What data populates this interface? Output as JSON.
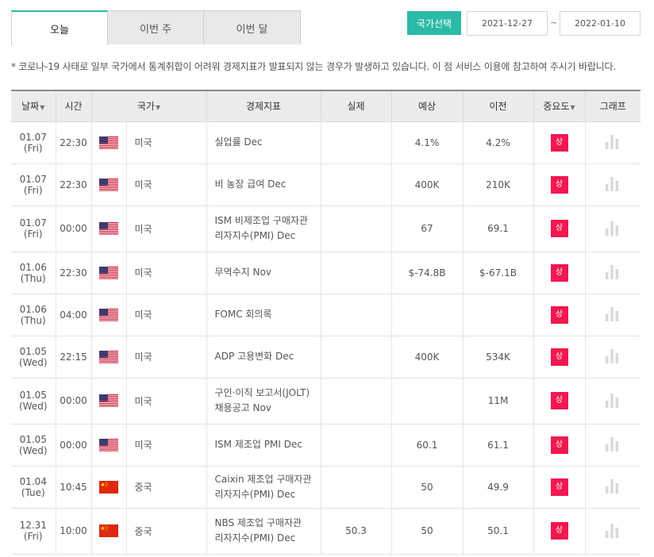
{
  "tabs": [
    {
      "label": "오늘",
      "active": true
    },
    {
      "label": "이번 주",
      "active": false
    },
    {
      "label": "이번 달",
      "active": false
    }
  ],
  "country_button": "국가선택",
  "date_range": {
    "from": "2021-12-27",
    "separator": "~",
    "to": "2022-01-10"
  },
  "notice": "* 코로나-19 사태로 일부 국가에서 통계취합이 어려워 경제지표가 발표되지 않는 경우가 발생하고 있습니다. 이 점 서비스 이용에 참고하여 주시기 바랍니다.",
  "columns": {
    "date": "날짜",
    "time": "시간",
    "country": "국가",
    "indicator": "경제지표",
    "actual": "실제",
    "forecast": "예상",
    "previous": "이전",
    "importance": "중요도",
    "graph": "그래프"
  },
  "sort_arrow": "▼",
  "colors": {
    "accent": "#2bbaa6",
    "importance_high": "#f0184f"
  },
  "rows": [
    {
      "date": "01.07",
      "day": "(Fri)",
      "time": "22:30",
      "flag": "us-flag-icon",
      "country": "미국",
      "indicator": [
        "실업률 Dec"
      ],
      "actual": "",
      "forecast": "4.1%",
      "previous": "4.2%",
      "importance": "상"
    },
    {
      "date": "01.07",
      "day": "(Fri)",
      "time": "22:30",
      "flag": "us-flag-icon",
      "country": "미국",
      "indicator": [
        "비 농장 급여 Dec"
      ],
      "actual": "",
      "forecast": "400K",
      "previous": "210K",
      "importance": "상"
    },
    {
      "date": "01.07",
      "day": "(Fri)",
      "time": "00:00",
      "flag": "us-flag-icon",
      "country": "미국",
      "indicator": [
        "ISM 비제조업 구매자관",
        "리자지수(PMI) Dec"
      ],
      "actual": "",
      "forecast": "67",
      "previous": "69.1",
      "importance": "상"
    },
    {
      "date": "01.06",
      "day": "(Thu)",
      "time": "22:30",
      "flag": "us-flag-icon",
      "country": "미국",
      "indicator": [
        "무역수지 Nov"
      ],
      "actual": "",
      "forecast": "$-74.8B",
      "previous": "$-67.1B",
      "importance": "상"
    },
    {
      "date": "01.06",
      "day": "(Thu)",
      "time": "04:00",
      "flag": "us-flag-icon",
      "country": "미국",
      "indicator": [
        "FOMC 회의록"
      ],
      "actual": "",
      "forecast": "",
      "previous": "",
      "importance": "상"
    },
    {
      "date": "01.05",
      "day": "(Wed)",
      "time": "22:15",
      "flag": "us-flag-icon",
      "country": "미국",
      "indicator": [
        "ADP 고용변화 Dec"
      ],
      "actual": "",
      "forecast": "400K",
      "previous": "534K",
      "importance": "상"
    },
    {
      "date": "01.05",
      "day": "(Wed)",
      "time": "00:00",
      "flag": "us-flag-icon",
      "country": "미국",
      "indicator": [
        "구인·이직 보고서(JOLT)",
        "채용공고 Nov"
      ],
      "actual": "",
      "forecast": "",
      "previous": "11M",
      "importance": "상"
    },
    {
      "date": "01.05",
      "day": "(Wed)",
      "time": "00:00",
      "flag": "us-flag-icon",
      "country": "미국",
      "indicator": [
        "ISM 제조업 PMI Dec"
      ],
      "actual": "",
      "forecast": "60.1",
      "previous": "61.1",
      "importance": "상"
    },
    {
      "date": "01.04",
      "day": "(Tue)",
      "time": "10:45",
      "flag": "cn-flag-icon",
      "country": "중국",
      "indicator": [
        "Caixin 제조업 구매자관",
        "리자지수(PMI) Dec"
      ],
      "actual": "",
      "forecast": "50",
      "previous": "49.9",
      "importance": "상"
    },
    {
      "date": "12.31",
      "day": "(Fri)",
      "time": "10:00",
      "flag": "cn-flag-icon",
      "country": "중국",
      "indicator": [
        "NBS 제조업 구매자관",
        "리자지수(PMI) Dec"
      ],
      "actual": "50.3",
      "forecast": "50",
      "previous": "50.1",
      "importance": "상"
    }
  ]
}
